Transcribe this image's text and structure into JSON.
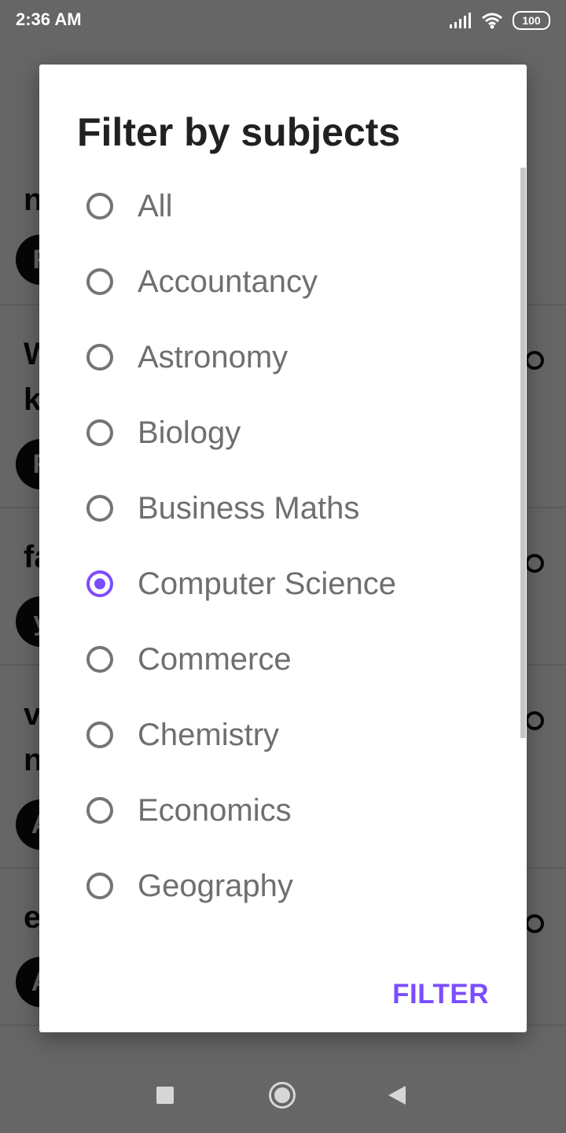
{
  "status_bar": {
    "time": "2:36 AM",
    "battery": "100"
  },
  "background": {
    "rows": [
      {
        "text": "n",
        "avatar": "F"
      },
      {
        "text": "W",
        "text2": "k",
        "avatar": "F"
      },
      {
        "text": "fa",
        "avatar": "y"
      },
      {
        "text": "v",
        "text2": "n",
        "avatar": "A"
      },
      {
        "text": "e",
        "avatar": "A"
      }
    ]
  },
  "dialog": {
    "title": "Filter by subjects",
    "options": [
      {
        "label": "All",
        "selected": false
      },
      {
        "label": "Accountancy",
        "selected": false
      },
      {
        "label": "Astronomy",
        "selected": false
      },
      {
        "label": "Biology",
        "selected": false
      },
      {
        "label": "Business Maths",
        "selected": false
      },
      {
        "label": "Computer Science",
        "selected": true
      },
      {
        "label": "Commerce",
        "selected": false
      },
      {
        "label": "Chemistry",
        "selected": false
      },
      {
        "label": "Economics",
        "selected": false
      },
      {
        "label": "Geography",
        "selected": false
      }
    ],
    "filter_label": "FILTER"
  },
  "colors": {
    "accent": "#7c4dff",
    "scrim": "#000000"
  }
}
